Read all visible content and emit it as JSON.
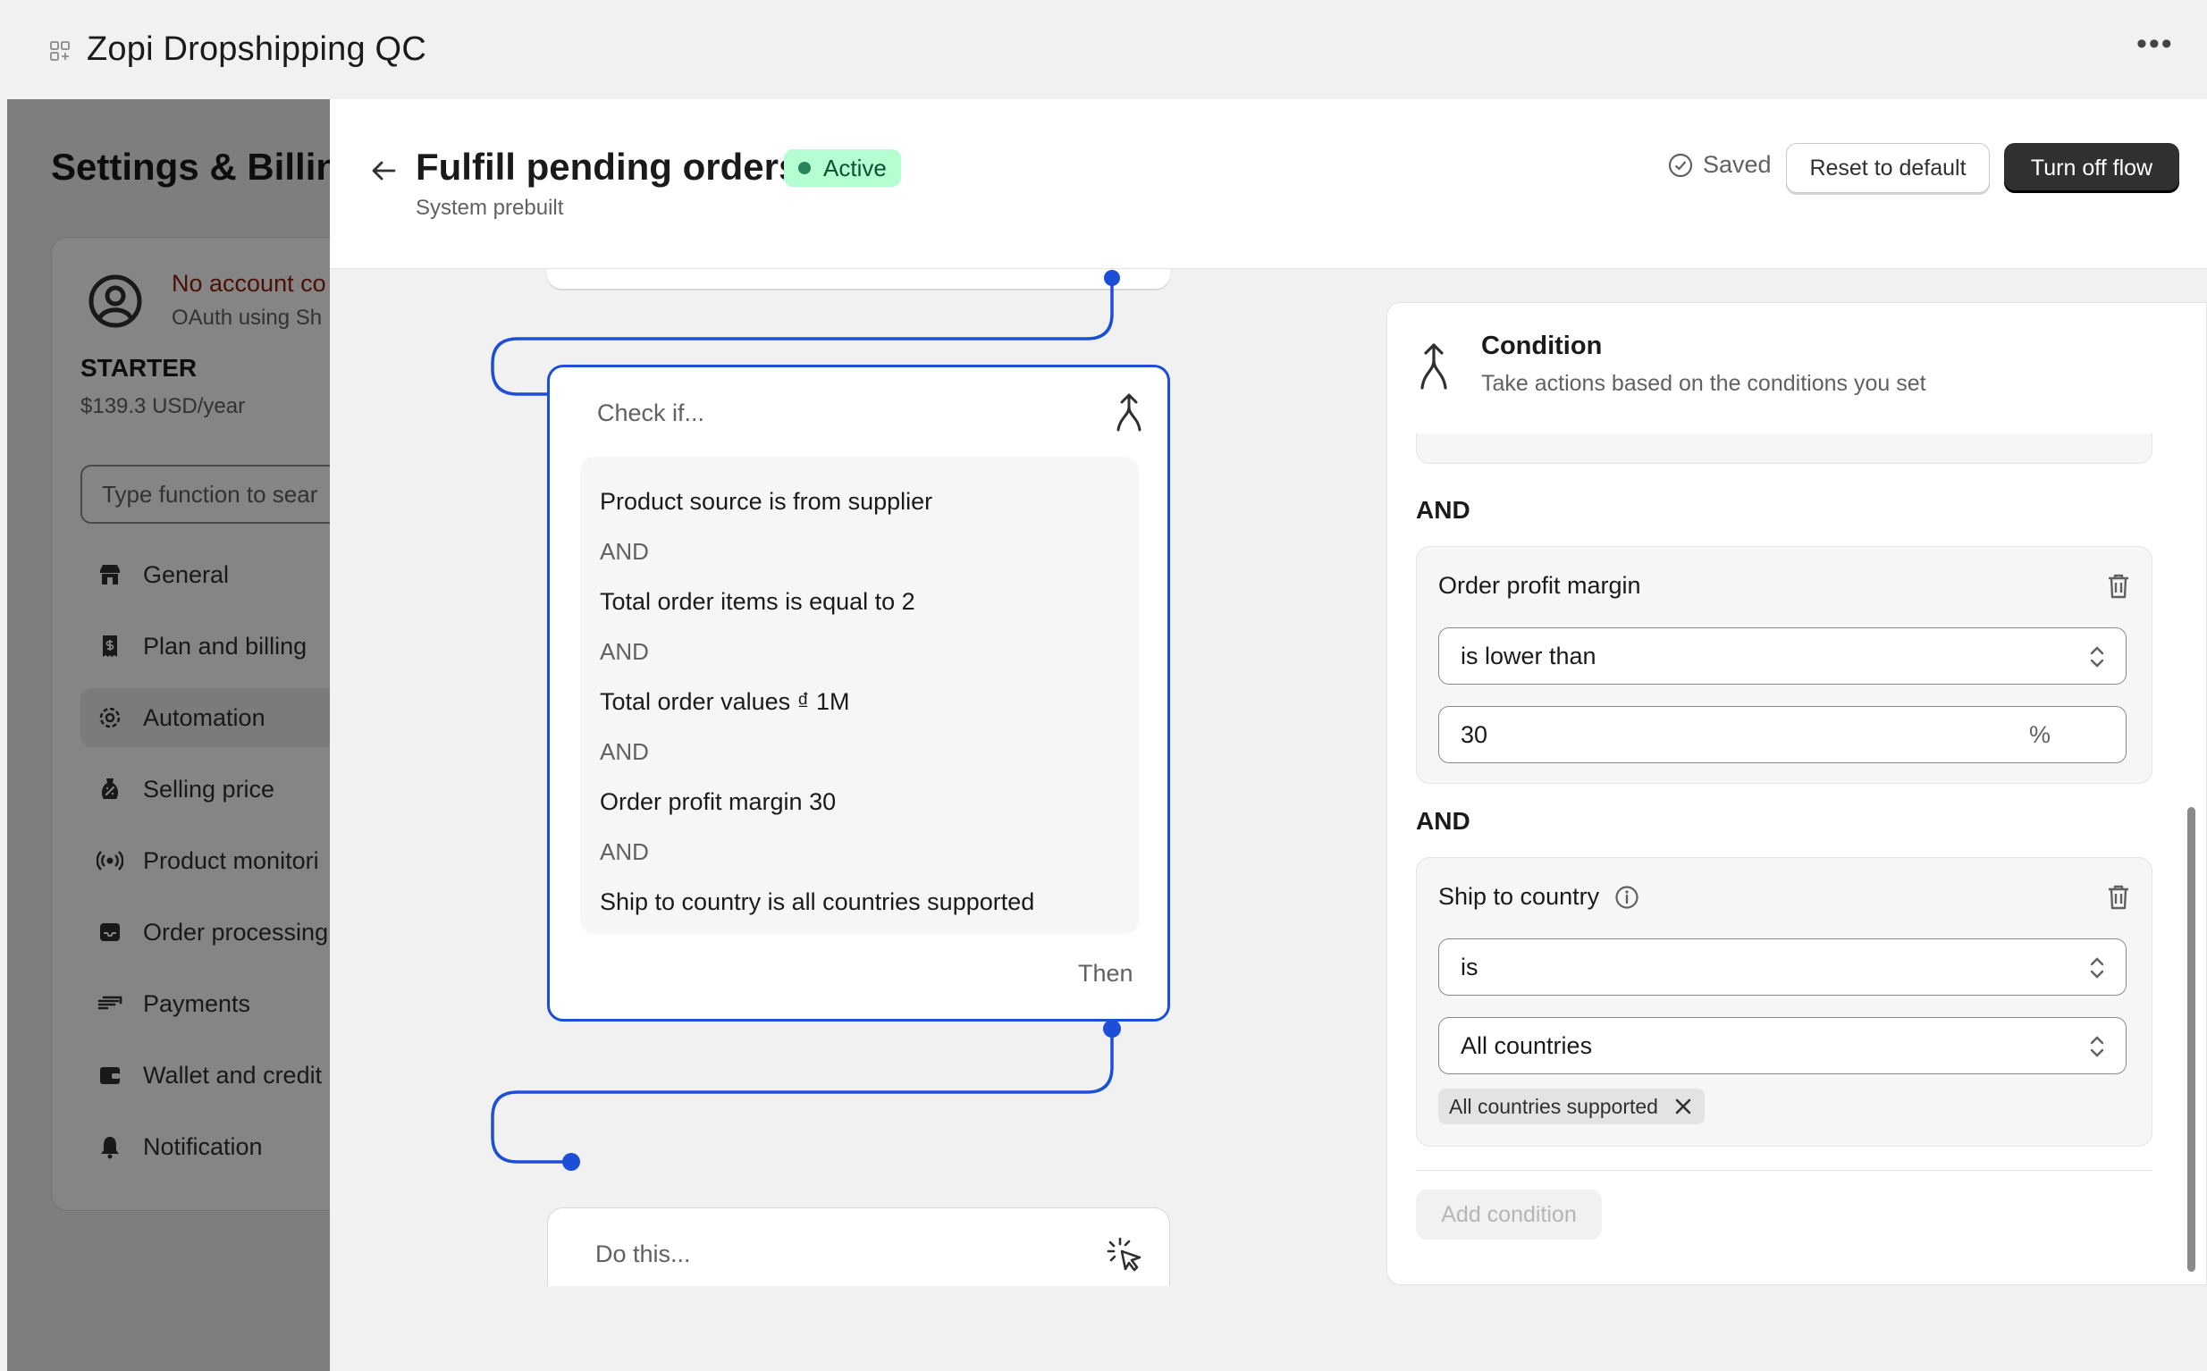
{
  "topbar": {
    "app_title": "Zopi Dropshipping QC",
    "app_icon": "grid-app-icon",
    "more_icon": "more-horizontal-icon",
    "more_label": "•••"
  },
  "left": {
    "settings_title": "Settings & Billing",
    "account_line1": "No account co",
    "account_line2": "OAuth using Sh",
    "plan_name": "STARTER",
    "plan_price": "$139.3 USD/year",
    "search_placeholder": "Type function to sear",
    "nav": [
      {
        "label": "General",
        "icon": "store-icon"
      },
      {
        "label": "Plan and billing",
        "icon": "receipt-icon"
      },
      {
        "label": "Automation",
        "icon": "gear-icon",
        "active": true
      },
      {
        "label": "Selling price",
        "icon": "price-tag-icon"
      },
      {
        "label": "Product monitori",
        "icon": "broadcast-icon"
      },
      {
        "label": "Order processing",
        "icon": "inbox-icon"
      },
      {
        "label": "Payments",
        "icon": "hand-card-icon"
      },
      {
        "label": "Wallet and credit",
        "icon": "wallet-icon"
      },
      {
        "label": "Notification",
        "icon": "bell-icon"
      }
    ]
  },
  "header": {
    "title": "Fulfill pending orders",
    "status": "Active",
    "subtitle": "System prebuilt",
    "saved_label": "Saved",
    "reset_label": "Reset to default",
    "turn_off_label": "Turn off flow"
  },
  "canvas": {
    "check_label": "Check if...",
    "conditions": [
      "Product source is from supplier",
      "Total order items is equal to 2",
      "Total order values ₫ 1M",
      "Order profit margin 30",
      "Ship to country is all countries supported"
    ],
    "and_label": "AND",
    "then_label": "Then",
    "do_label": "Do this..."
  },
  "panel": {
    "title": "Condition",
    "description": "Take actions based on the conditions you set",
    "and_label": "AND",
    "profit_block": {
      "title": "Order profit margin",
      "operator": "is lower than",
      "value": "30",
      "suffix": "%"
    },
    "country_block": {
      "title": "Ship to country",
      "operator": "is",
      "value": "All countries",
      "tag": "All countries supported"
    },
    "add_condition_label": "Add condition"
  },
  "colors": {
    "accent_blue": "#1d4ed8",
    "active_badge_bg": "#b4fed2",
    "active_badge_text": "#0c5132",
    "primary_button": "#303030"
  }
}
